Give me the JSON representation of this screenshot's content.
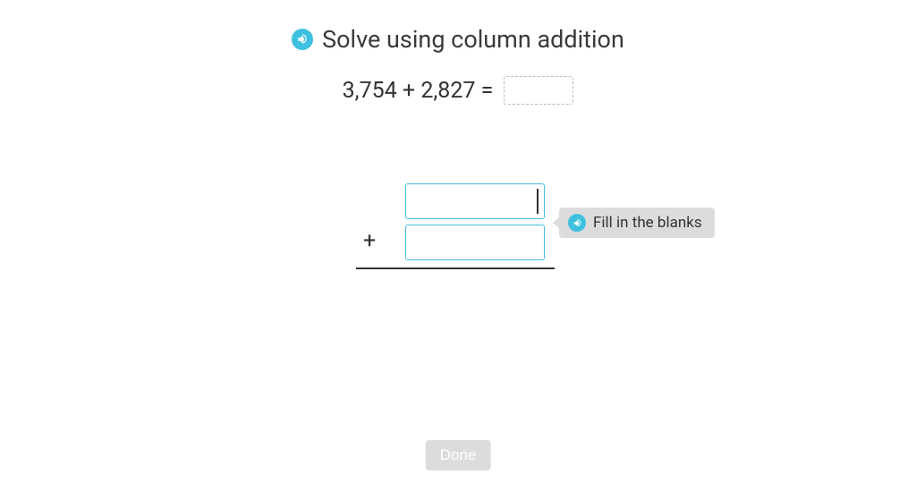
{
  "header": {
    "title": "Solve using column addition"
  },
  "equation": {
    "text": "3,754 + 2,827 ="
  },
  "column": {
    "operator": "+"
  },
  "tooltip": {
    "text": "Fill in the blanks"
  },
  "buttons": {
    "done": "Done"
  }
}
